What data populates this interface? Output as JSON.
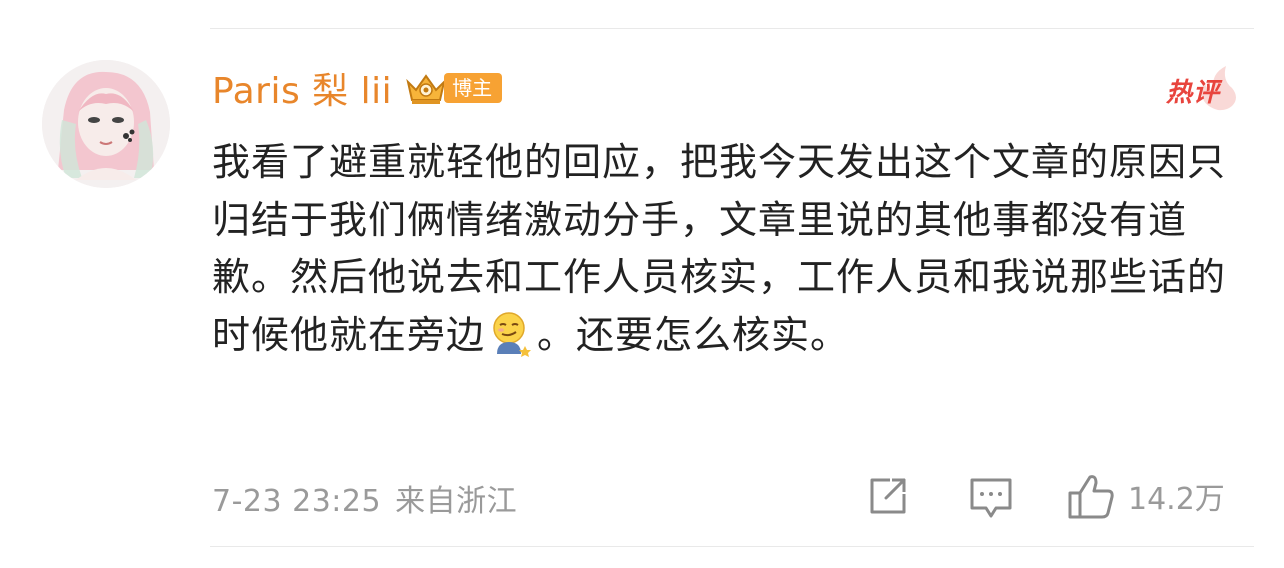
{
  "user": {
    "name": "Paris 梨 lii",
    "role_badge": "博主"
  },
  "hot_badge": "热评",
  "comment": {
    "text_part1": "我看了避重就轻他的回应，把我今天发出这个文章的原因只归结于我们俩情绪激动分手，文章里说的其他事都没有道歉。然后他说去和工作人员核实，工作人员和我说那些话的时候他就在旁边",
    "emoji": "smirk-emoji",
    "text_part2": "。还要怎么核实。"
  },
  "meta": {
    "timestamp": "7-23 23:25",
    "location": "来自浙江"
  },
  "actions": {
    "like_count": "14.2万"
  },
  "colors": {
    "username": "#e8862b",
    "badge": "#f7a233",
    "hot": "#e8443d",
    "meta": "#9a9a9a",
    "text": "#222222"
  },
  "icons": [
    "avatar",
    "crown-icon",
    "flame-icon",
    "share-icon",
    "comment-icon",
    "like-icon"
  ]
}
